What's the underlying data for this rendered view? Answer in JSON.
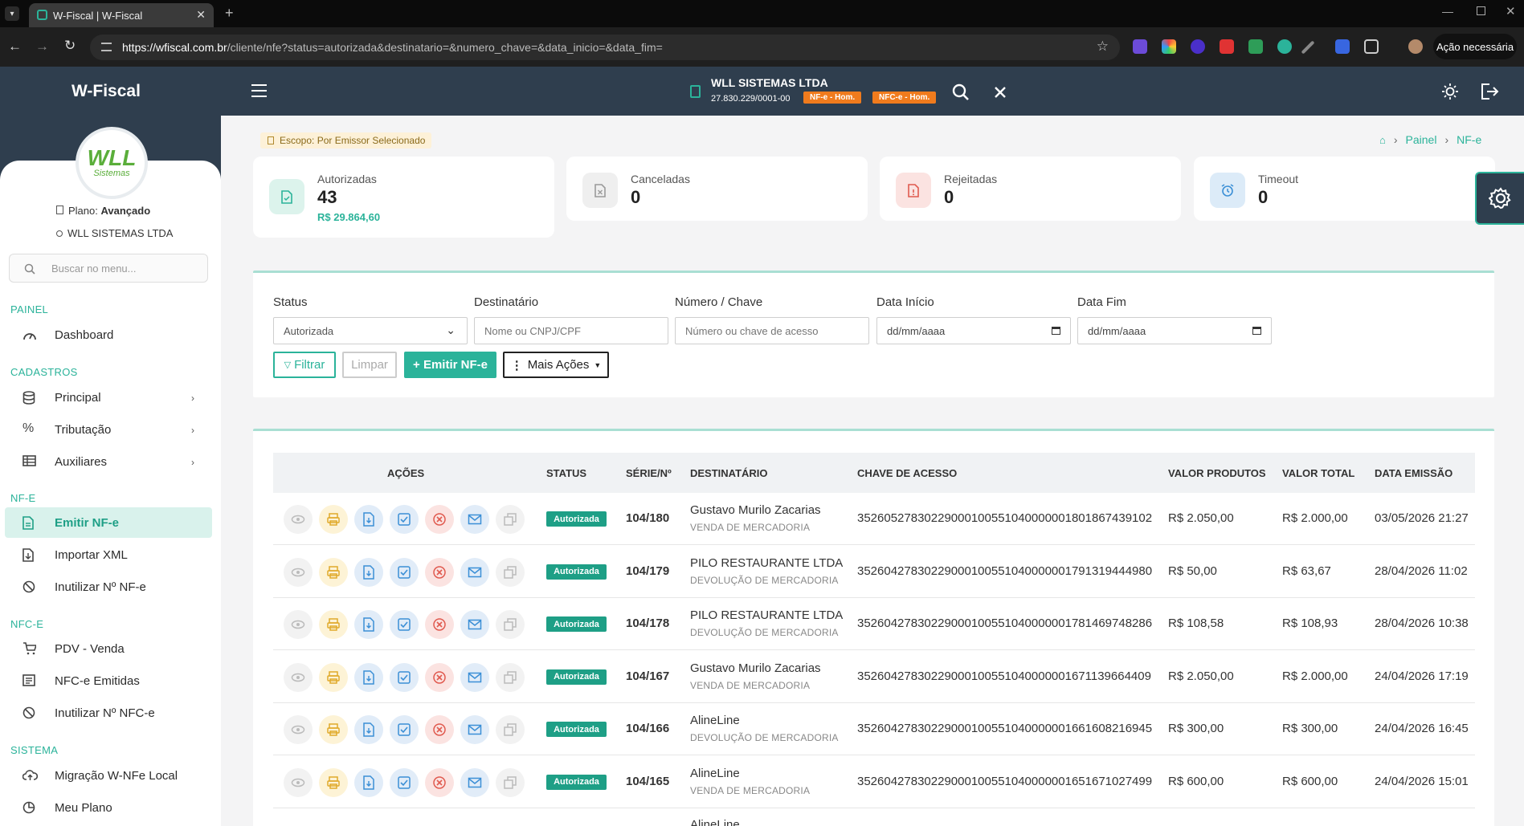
{
  "browser": {
    "tab_title": "W-Fiscal | W-Fiscal",
    "url_host": "https://wfiscal.com.br",
    "url_path": "/cliente/nfe?status=autorizada&destinatario=&numero_chave=&data_inicio=&data_fim=",
    "profile_button": "Ação necessária"
  },
  "header": {
    "brand": "W-Fiscal",
    "company": "WLL SISTEMAS LTDA",
    "cnpj": "27.830.229/0001-00",
    "badges": [
      "NF-e - Hom.",
      "NFC-e - Hom."
    ]
  },
  "sidebar": {
    "logo_text": "WLL",
    "logo_sub": "Sistemas",
    "plan_label": "Plano:",
    "plan_value": "Avançado",
    "user": "WLL SISTEMAS LTDA",
    "search_placeholder": "Buscar no menu...",
    "sections": [
      {
        "title": "PAINEL",
        "items": [
          {
            "label": "Dashboard",
            "icon": "gauge-icon"
          }
        ]
      },
      {
        "title": "CADASTROS",
        "items": [
          {
            "label": "Principal",
            "icon": "database-icon"
          },
          {
            "label": "Tributação",
            "icon": "percent-icon"
          },
          {
            "label": "Auxiliares",
            "icon": "table-icon"
          }
        ]
      },
      {
        "title": "NF-E",
        "items": [
          {
            "label": "Emitir NF-e",
            "icon": "file-icon"
          },
          {
            "label": "Importar XML",
            "icon": "file-import-icon"
          },
          {
            "label": "Inutilizar Nº NF-e",
            "icon": "ban-icon"
          }
        ]
      },
      {
        "title": "NFC-E",
        "items": [
          {
            "label": "PDV - Venda",
            "icon": "cart-icon"
          },
          {
            "label": "NFC-e Emitidas",
            "icon": "receipt-icon"
          },
          {
            "label": "Inutilizar Nº NFC-e",
            "icon": "ban-icon"
          }
        ]
      },
      {
        "title": "SISTEMA",
        "items": [
          {
            "label": "Migração W-NFe Local",
            "icon": "cloud-upload-icon"
          },
          {
            "label": "Meu Plano",
            "icon": "pie-icon"
          }
        ]
      }
    ]
  },
  "scope": "Escopo: Por Emissor Selecionado",
  "breadcrumb": [
    "Painel",
    "NF-e"
  ],
  "stats": [
    {
      "label": "Autorizadas",
      "value": "43",
      "sub": "R$ 29.864,60",
      "color": "#2bb39a"
    },
    {
      "label": "Canceladas",
      "value": "0",
      "sub": "",
      "color": "#9a9a9a"
    },
    {
      "label": "Rejeitadas",
      "value": "0",
      "sub": "",
      "color": "#e05a4f"
    },
    {
      "label": "Timeout",
      "value": "0",
      "sub": "",
      "color": "#3b8fd6"
    }
  ],
  "filters": {
    "status_label": "Status",
    "status_value": "Autorizada",
    "dest_label": "Destinatário",
    "dest_placeholder": "Nome ou CNPJ/CPF",
    "num_label": "Número / Chave",
    "num_placeholder": "Número ou chave de acesso",
    "ini_label": "Data Início",
    "ini_value": "dd/mm/aaaa",
    "fim_label": "Data Fim",
    "fim_value": "dd/mm/aaaa",
    "btn_filtrar": "Filtrar",
    "btn_limpar": "Limpar",
    "btn_emitir": "+ Emitir NF-e",
    "btn_mais": "Mais Ações"
  },
  "table": {
    "headers": [
      "AÇÕES",
      "STATUS",
      "SÉRIE/Nº",
      "DESTINATÁRIO",
      "CHAVE DE ACESSO",
      "VALOR PRODUTOS",
      "VALOR TOTAL",
      "DATA EMISSÃO"
    ],
    "rows": [
      {
        "status": "Autorizada",
        "serie": "104/180",
        "dest": "Gustavo Murilo Zacarias",
        "nat": "VENDA DE MERCADORIA",
        "chave": "35260527830229000100551040000001801867439102",
        "vprod": "R$ 2.050,00",
        "vtotal": "R$ 2.000,00",
        "data": "03/05/2026 21:27"
      },
      {
        "status": "Autorizada",
        "serie": "104/179",
        "dest": "PILO RESTAURANTE LTDA",
        "nat": "DEVOLUÇÃO DE MERCADORIA",
        "chave": "35260427830229000100551040000001791319444980",
        "vprod": "R$ 50,00",
        "vtotal": "R$ 63,67",
        "data": "28/04/2026 11:02"
      },
      {
        "status": "Autorizada",
        "serie": "104/178",
        "dest": "PILO RESTAURANTE LTDA",
        "nat": "DEVOLUÇÃO DE MERCADORIA",
        "chave": "35260427830229000100551040000001781469748286",
        "vprod": "R$ 108,58",
        "vtotal": "R$ 108,93",
        "data": "28/04/2026 10:38"
      },
      {
        "status": "Autorizada",
        "serie": "104/167",
        "dest": "Gustavo Murilo Zacarias",
        "nat": "VENDA DE MERCADORIA",
        "chave": "35260427830229000100551040000001671139664409",
        "vprod": "R$ 2.050,00",
        "vtotal": "R$ 2.000,00",
        "data": "24/04/2026 17:19"
      },
      {
        "status": "Autorizada",
        "serie": "104/166",
        "dest": "AlineLine",
        "nat": "DEVOLUÇÃO DE MERCADORIA",
        "chave": "35260427830229000100551040000001661608216945",
        "vprod": "R$ 300,00",
        "vtotal": "R$ 300,00",
        "data": "24/04/2026 16:45"
      },
      {
        "status": "Autorizada",
        "serie": "104/165",
        "dest": "AlineLine",
        "nat": "VENDA DE MERCADORIA",
        "chave": "35260427830229000100551040000001651671027499",
        "vprod": "R$ 600,00",
        "vtotal": "R$ 600,00",
        "data": "24/04/2026 15:01"
      }
    ],
    "partial_row_dest": "AlineLine"
  }
}
